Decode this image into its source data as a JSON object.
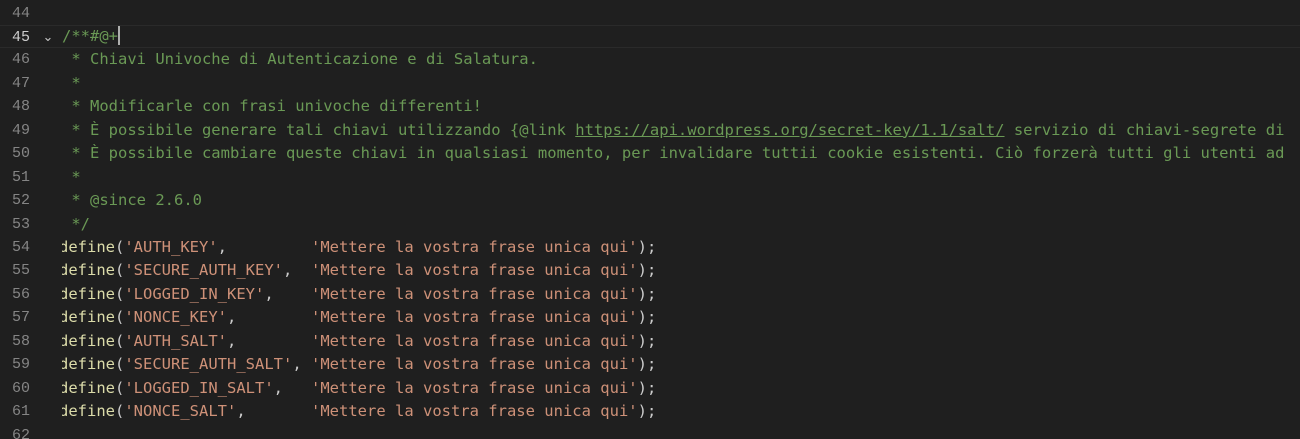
{
  "editor": {
    "lines": [
      {
        "number": "44",
        "kind": "blank"
      },
      {
        "number": "45",
        "kind": "doc-open",
        "text": "/**#@+",
        "fold": "⌄",
        "active": true
      },
      {
        "number": "46",
        "kind": "comment",
        "text": " * Chiavi Univoche di Autenticazione e di Salatura."
      },
      {
        "number": "47",
        "kind": "comment",
        "text": " *"
      },
      {
        "number": "48",
        "kind": "comment",
        "text": " * Modificarle con frasi univoche differenti!"
      },
      {
        "number": "49",
        "kind": "comment-link",
        "before": " * È possibile generare tali chiavi utilizzando {@link ",
        "link": "https://api.wordpress.org/secret-key/1.1/salt/",
        "after": " servizio di chiavi-segrete di"
      },
      {
        "number": "50",
        "kind": "comment",
        "text": " * È possibile cambiare queste chiavi in qualsiasi momento, per invalidare tuttii cookie esistenti. Ciò forzerà tutti gli utenti ad"
      },
      {
        "number": "51",
        "kind": "comment",
        "text": " *"
      },
      {
        "number": "52",
        "kind": "comment",
        "text": " * @since 2.6.0"
      },
      {
        "number": "53",
        "kind": "comment",
        "text": " */"
      },
      {
        "number": "54",
        "kind": "define",
        "fn": "define",
        "key": "'AUTH_KEY'",
        "pad": "         ",
        "value": "'Mettere la vostra frase unica qui'"
      },
      {
        "number": "55",
        "kind": "define",
        "fn": "define",
        "key": "'SECURE_AUTH_KEY'",
        "pad": "  ",
        "value": "'Mettere la vostra frase unica qui'"
      },
      {
        "number": "56",
        "kind": "define",
        "fn": "define",
        "key": "'LOGGED_IN_KEY'",
        "pad": "    ",
        "value": "'Mettere la vostra frase unica qui'"
      },
      {
        "number": "57",
        "kind": "define",
        "fn": "define",
        "key": "'NONCE_KEY'",
        "pad": "        ",
        "value": "'Mettere la vostra frase unica qui'"
      },
      {
        "number": "58",
        "kind": "define",
        "fn": "define",
        "key": "'AUTH_SALT'",
        "pad": "        ",
        "value": "'Mettere la vostra frase unica qui'"
      },
      {
        "number": "59",
        "kind": "define",
        "fn": "define",
        "key": "'SECURE_AUTH_SALT'",
        "pad": " ",
        "value": "'Mettere la vostra frase unica qui'"
      },
      {
        "number": "60",
        "kind": "define",
        "fn": "define",
        "key": "'LOGGED_IN_SALT'",
        "pad": "   ",
        "value": "'Mettere la vostra frase unica qui'"
      },
      {
        "number": "61",
        "kind": "define",
        "fn": "define",
        "key": "'NONCE_SALT'",
        "pad": "       ",
        "value": "'Mettere la vostra frase unica qui'"
      },
      {
        "number": "62",
        "kind": "blank"
      }
    ]
  },
  "colors": {
    "background": "#1f1f1f",
    "comment": "#6a9955",
    "function": "#dcdcaa",
    "string": "#ce9178",
    "line_number": "#858585"
  },
  "icons": {
    "fold": "chevron-down-icon"
  }
}
